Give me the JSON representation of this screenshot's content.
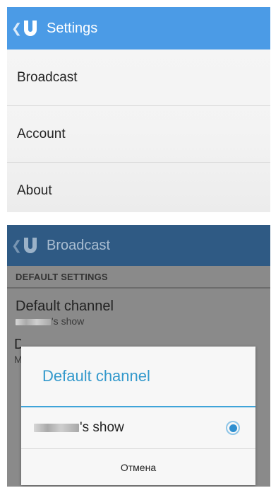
{
  "settings_screen": {
    "title": "Settings",
    "menu": [
      {
        "label": "Broadcast"
      },
      {
        "label": "Account"
      },
      {
        "label": "About"
      }
    ]
  },
  "broadcast_screen": {
    "title": "Broadcast",
    "section_header": "DEFAULT SETTINGS",
    "default_channel_pref": {
      "title": "Default channel",
      "subtitle_suffix": "'s show"
    },
    "second_pref": {
      "title_initial": "D",
      "subtitle_initial": "M"
    }
  },
  "dialog": {
    "title": "Default channel",
    "option_suffix": "'s show",
    "option_selected": true,
    "cancel_label": "Отмена"
  },
  "colors": {
    "appbar": "#4b9be6",
    "appbar_dimmed": "#2f5a84",
    "dialog_accent": "#3399cc"
  },
  "icons": [
    "back-chevron-icon",
    "app-logo-u-icon",
    "radio-selected-icon"
  ]
}
